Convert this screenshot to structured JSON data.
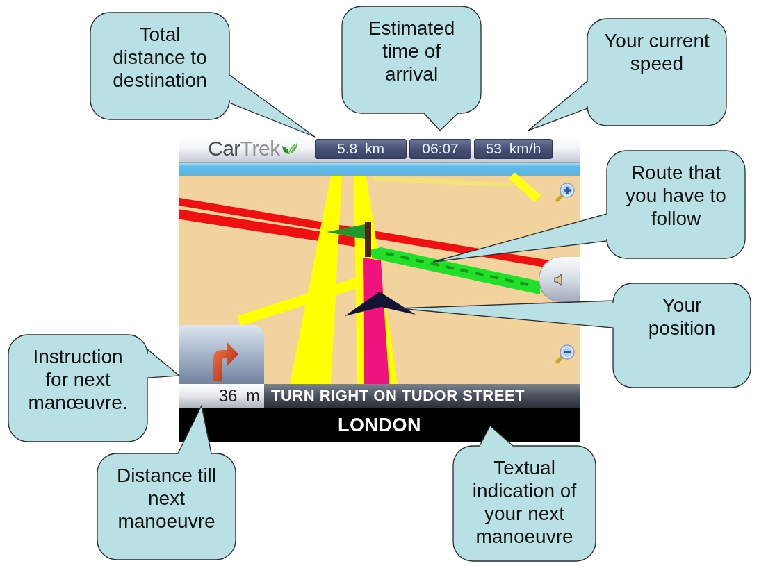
{
  "screen": {
    "top_bar": {
      "logo": [
        "Car",
        "Trek"
      ],
      "readouts": [
        "5.8 km",
        "06:07",
        "53 km/h"
      ]
    },
    "next_turn": {
      "distance": "36 m",
      "instruction": "TURN RIGHT ON TUDOR STREET"
    },
    "city": "LONDON"
  },
  "callouts": [
    {
      "text": "Total distance to destination"
    },
    {
      "text": "Estimated time of arrival"
    },
    {
      "text": "Your current speed"
    },
    {
      "text": "Route that you have to follow"
    },
    {
      "text": "Your position"
    },
    {
      "text": "Instruction for next manœuvre."
    },
    {
      "text": "Distance till next manoeuvre"
    },
    {
      "text": "Textual indication of your next manoeuvre"
    }
  ]
}
